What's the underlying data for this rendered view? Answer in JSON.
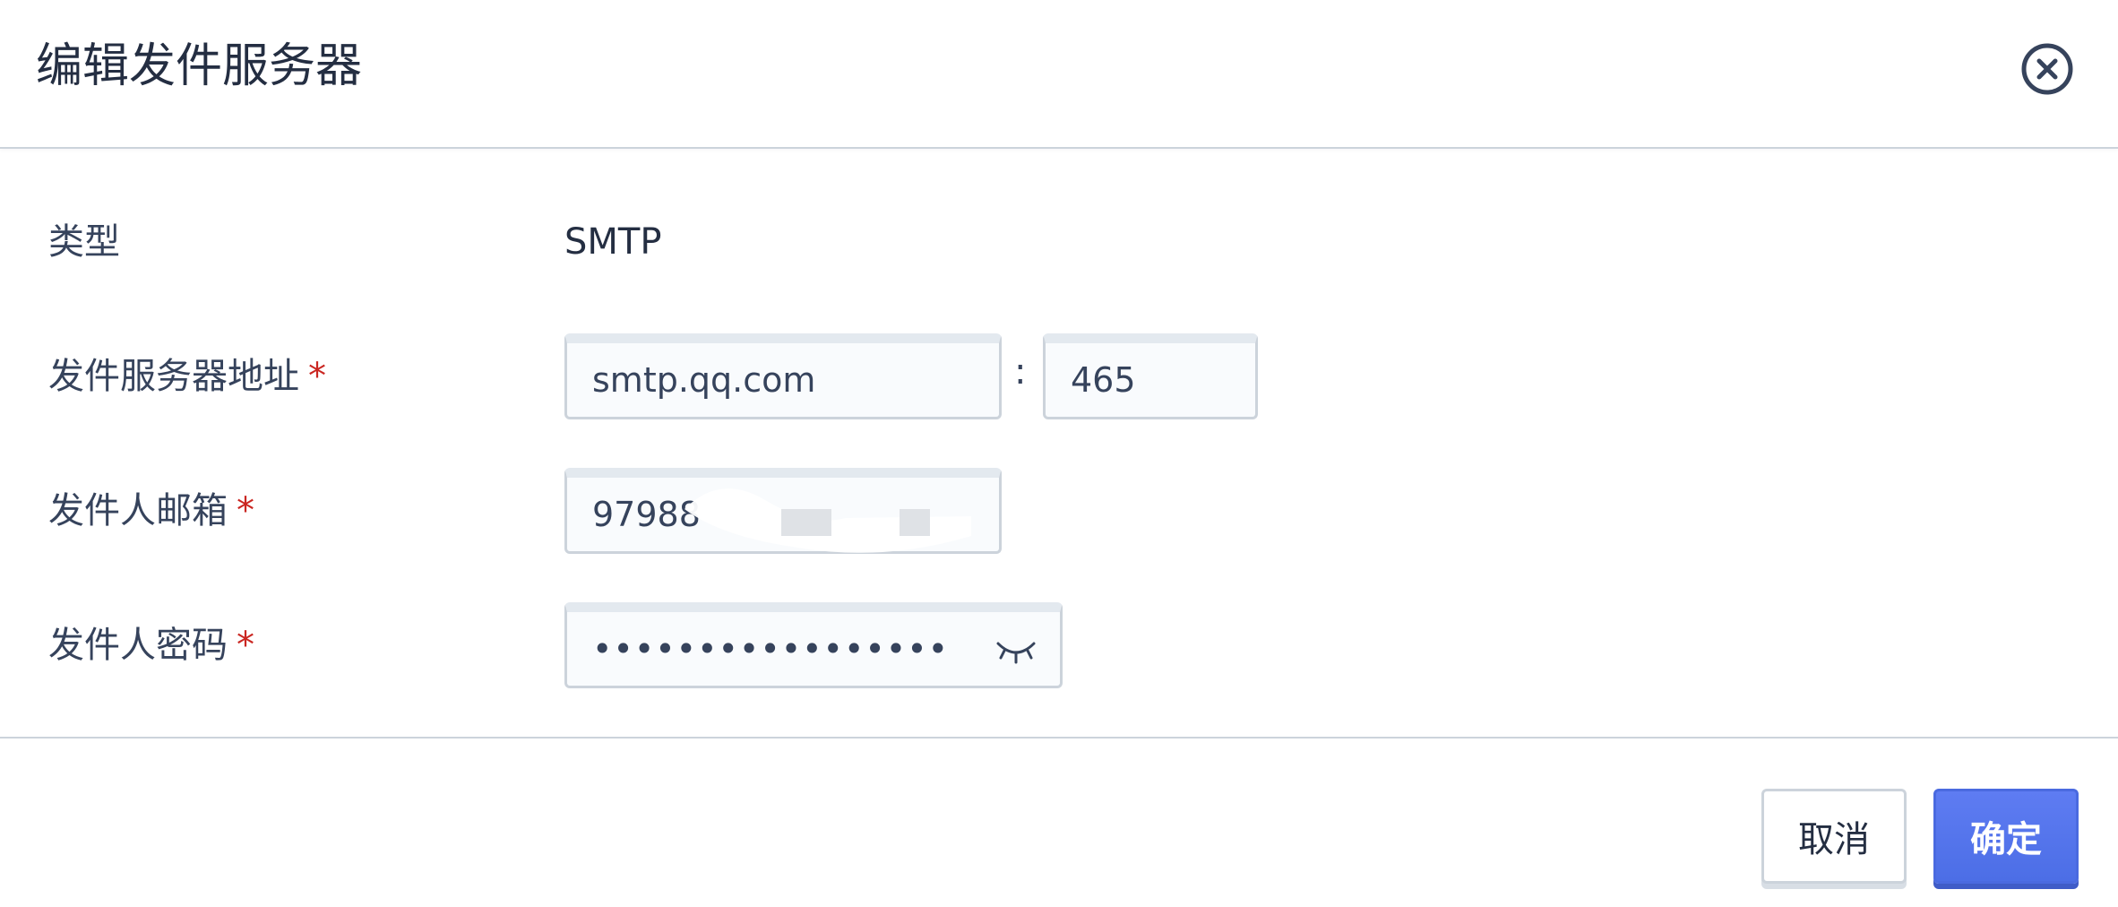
{
  "dialog": {
    "title": "编辑发件服务器",
    "close_icon": "close-circle-icon"
  },
  "form": {
    "type": {
      "label": "类型",
      "value": "SMTP"
    },
    "server": {
      "label": "发件服务器地址",
      "required": "*",
      "host": "smtp.qq.com",
      "separator": ":",
      "port": "465"
    },
    "sender_email": {
      "label": "发件人邮箱",
      "required": "*",
      "value": "97988"
    },
    "sender_password": {
      "label": "发件人密码",
      "required": "*",
      "value": "•••••••••••••••••",
      "toggle_icon": "eye-closed-icon"
    }
  },
  "footer": {
    "cancel_label": "取消",
    "confirm_label": "确定"
  },
  "colors": {
    "primary": "#4c6ee6",
    "required": "#ca2621",
    "border": "#ccd3db"
  }
}
